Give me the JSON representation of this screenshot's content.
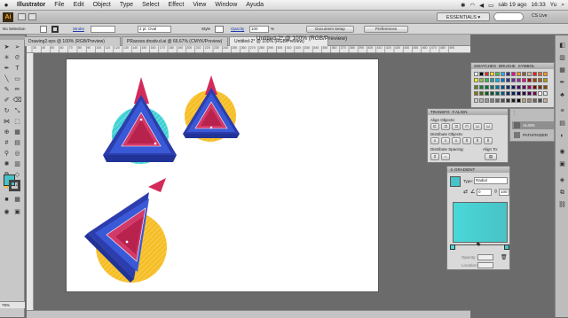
{
  "menubar": {
    "apple": "",
    "app": "Illustrator",
    "items": [
      "File",
      "Edit",
      "Object",
      "Type",
      "Select",
      "Effect",
      "View",
      "Window",
      "Ayuda"
    ],
    "date": "sáb 19 ago",
    "time": "16:33",
    "user": "Yu"
  },
  "appbar": {
    "logo": "Ai",
    "workspace": "ESSENTIALS ▾",
    "cslive": "CS Live"
  },
  "control": {
    "selection": "No Selection",
    "stroke_label": "Stroke",
    "stroke_value": "",
    "brush": "2 pt. Oval",
    "style_label": "Style",
    "opacity_label": "Opacity",
    "opacity_value": "100",
    "opacity_unit": "%",
    "doc_setup": "Document Setup",
    "preferences": "Preferences"
  },
  "window_title": "Untitled-2* @ 100% (RGB/Preview)",
  "tabs": [
    "Drawing2.eps @ 100% (RGB/Preview)",
    "PRaceso.dnsdv.d.ai @ 66.67% (CMYK/Preview)",
    "Untitled-2* @ 100% (RGB/Preview)"
  ],
  "status": {
    "zoom": "79%"
  },
  "colors": {
    "fill": "#48c2c6",
    "accent": "#3157d3"
  },
  "swatches_panel": {
    "tabs": [
      "SWATCHES",
      "BRUSHE",
      "SYMBOL"
    ],
    "colors": [
      "#ffffff",
      "#000000",
      "#e12a2a",
      "#f5e000",
      "#4ab84a",
      "#29abe2",
      "#2e3192",
      "#ec008c",
      "#f7941d",
      "#8c6239",
      "#c7b299",
      "#ed1c24",
      "#f26522",
      "#f7941d",
      "#fff200",
      "#8dc63f",
      "#39b54a",
      "#00a99d",
      "#00aeef",
      "#0072bc",
      "#2e3192",
      "#662d91",
      "#92278f",
      "#ec008c",
      "#9e0b0f",
      "#a0410d",
      "#a36209",
      "#aba000",
      "#598527",
      "#197b30",
      "#007236",
      "#00746b",
      "#0076a3",
      "#004a80",
      "#003471",
      "#1b1464",
      "#440e62",
      "#630460",
      "#9e005d",
      "#790000",
      "#7b2e00",
      "#7d4900",
      "#827b00",
      "#406618",
      "#005e20",
      "#005826",
      "#005952",
      "#005b7f",
      "#003663",
      "#002157",
      "#0d004c",
      "#32004b",
      "#4b0049",
      "#7b0046",
      "#ffffff",
      "#e6e6e6",
      "#cccccc",
      "#b3b3b3",
      "#999999",
      "#808080",
      "#666666",
      "#4d4d4d",
      "#333333",
      "#1a1a1a",
      "#000000",
      "#c69c6d",
      "#998675",
      "#736357",
      "#534741",
      "#c7b299"
    ]
  },
  "align_panel": {
    "tabs": [
      "TRANSFO",
      "# ALIGN"
    ],
    "align_objects": "Align Objects:",
    "distribute_objects": "Distribute Objects:",
    "distribute_spacing": "Distribute Spacing:",
    "align_to": "Align To:"
  },
  "mini_dock": {
    "align": "ALIGN",
    "pathfinder": "PATHFINDER"
  },
  "gradient_panel": {
    "title": "≎ GRADIENT",
    "type_label": "Type:",
    "type_value": "Radial",
    "angle": "0",
    "aspect": "100",
    "stop_left": "#4ad8d8",
    "stop_right": "#48c2c6",
    "opacity_label": "Opacity:",
    "location_label": "Location:"
  },
  "ruler_numbers": [
    "30",
    "40",
    "50",
    "60",
    "70",
    "80",
    "90",
    "100",
    "110",
    "120",
    "130",
    "140",
    "150",
    "160",
    "170",
    "180",
    "190",
    "200",
    "210",
    "220",
    "230",
    "240",
    "250",
    "260",
    "270",
    "280",
    "290",
    "300",
    "310",
    "320",
    "330",
    "340",
    "350",
    "360",
    "370",
    "380",
    "390",
    "400",
    "410",
    "420",
    "430",
    "440",
    "450",
    "460",
    "470",
    "480",
    "490"
  ]
}
